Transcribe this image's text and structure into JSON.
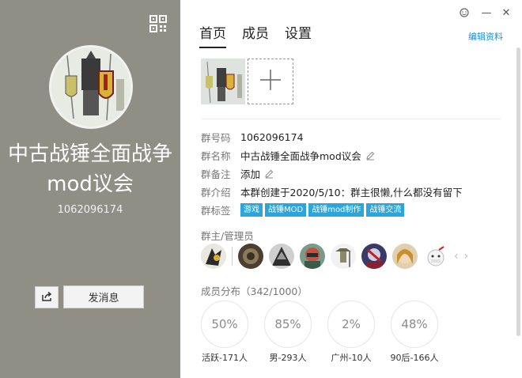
{
  "window": {
    "min_label": "—",
    "close_label": "✕"
  },
  "left": {
    "group_name": "中古战锤全面战争mod议会",
    "group_id": "1062096174",
    "send_message_label": "发消息"
  },
  "tabs": [
    {
      "label": "首页",
      "active": true
    },
    {
      "label": "成员",
      "active": false
    },
    {
      "label": "设置",
      "active": false
    }
  ],
  "edit_profile_label": "编辑资料",
  "info": {
    "number_label": "群号码",
    "number_value": "1062096174",
    "name_label": "群名称",
    "name_value": "中古战锤全面战争mod议会",
    "remark_label": "群备注",
    "remark_value": "添加",
    "intro_label": "群介绍",
    "intro_value": "本群创建于2020/5/10：群主很懒,什么都没有留下",
    "tags_label": "群标签",
    "tags": [
      "游戏",
      "战锤MOD",
      "战锤mod制作",
      "战锤交流"
    ]
  },
  "admins_title": "群主/管理员",
  "distribution": {
    "title": "成员分布（342/1000）",
    "stats": [
      {
        "value": "50%",
        "label": "活跃-171人"
      },
      {
        "value": "85%",
        "label": "男-293人"
      },
      {
        "value": "2%",
        "label": "广州-10人"
      },
      {
        "value": "48%",
        "label": "90后-166人"
      }
    ]
  },
  "colors": {
    "left_bg": "#8f8f86",
    "accent": "#1a8fd6",
    "tag_bg": "#2ba5dc"
  }
}
